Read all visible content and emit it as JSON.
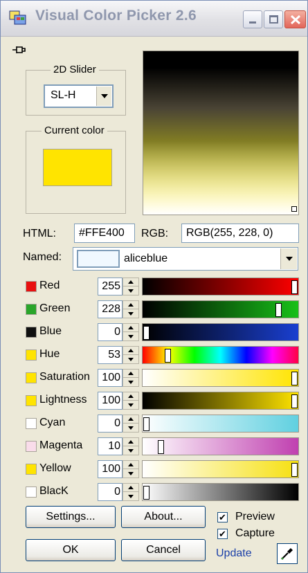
{
  "window": {
    "title": "Visual Color Picker 2.6"
  },
  "slider2d": {
    "group_label": "2D Slider",
    "mode": "SL-H"
  },
  "current_color": {
    "group_label": "Current color",
    "hex": "#ffe400"
  },
  "html_field": {
    "label": "HTML:",
    "value": "#FFE400"
  },
  "rgb_field": {
    "label": "RGB:",
    "value": "RGB(255, 228, 0)"
  },
  "named": {
    "label": "Named:",
    "value": "aliceblue",
    "swatch": "#f0f8ff"
  },
  "channels": [
    {
      "label": "Red",
      "value": "255",
      "swatch": "#e81010",
      "level": 1.0
    },
    {
      "label": "Green",
      "value": "228",
      "swatch": "#2aa52a",
      "level": 0.894
    },
    {
      "label": "Blue",
      "value": "0",
      "swatch": "#101010",
      "level": 0.0
    },
    {
      "label": "Hue",
      "value": "53",
      "swatch": "#ffe400",
      "level": 0.147
    },
    {
      "label": "Saturation",
      "value": "100",
      "swatch": "#ffe400",
      "level": 1.0
    },
    {
      "label": "Lightness",
      "value": "100",
      "swatch": "#ffe400",
      "level": 1.0
    },
    {
      "label": "Cyan",
      "value": "0",
      "swatch": "#ffffff",
      "level": 0.0
    },
    {
      "label": "Magenta",
      "value": "10",
      "swatch": "#f9dcea",
      "level": 0.1
    },
    {
      "label": "Yellow",
      "value": "100",
      "swatch": "#ffe400",
      "level": 1.0
    },
    {
      "label": "BlacK",
      "value": "0",
      "swatch": "#ffffff",
      "level": 0.0
    }
  ],
  "buttons": {
    "settings": "Settings...",
    "about": "About...",
    "ok": "OK",
    "cancel": "Cancel"
  },
  "checkboxes": {
    "preview": "Preview",
    "capture": "Capture"
  },
  "update_link": "Update",
  "icons": {
    "app": "color-picker-app-icon",
    "pin": "pin-icon",
    "eyedropper": "eyedropper-icon"
  }
}
